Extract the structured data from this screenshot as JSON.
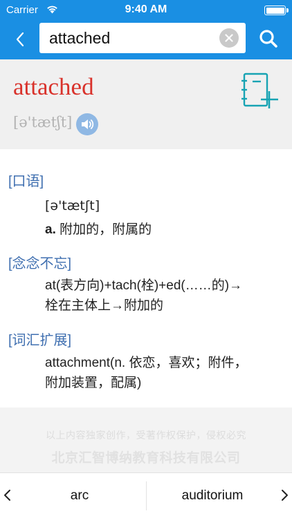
{
  "status_bar": {
    "carrier": "Carrier",
    "time": "9:40 AM"
  },
  "search": {
    "value": "attached"
  },
  "word": {
    "headword": "attached",
    "phonetic": "[ə'tætʃt]"
  },
  "sections": [
    {
      "title": "[口语]",
      "lines": [
        "[ə'tætʃt]"
      ],
      "pos": "a.",
      "definition": " 附加的，附属的"
    },
    {
      "title": "[念念不忘]",
      "lines": [
        "at(表方向)+tach(栓)+ed(……的)→",
        "栓在主体上→附加的"
      ]
    },
    {
      "title": "[词汇扩展]",
      "lines": [
        "attachment(n. 依恋，喜欢；附件，",
        "附加装置，配属)"
      ]
    }
  ],
  "copyright": {
    "line1": "以上内容独家创作，受著作权保护，侵权必究",
    "line2": "北京汇智博纳教育科技有限公司"
  },
  "bottom_nav": {
    "prev_word": "arc",
    "next_word": "auditorium"
  },
  "colors": {
    "header_blue": "#1a8fe3",
    "headword_red": "#d9322b",
    "section_blue": "#3f6fb0",
    "notebook_teal": "#17a3b3"
  },
  "icons": [
    "wifi-icon",
    "battery-icon",
    "chevron-left-icon",
    "clear-icon",
    "search-icon",
    "speaker-icon",
    "notebook-add-icon",
    "chevron-right-icon"
  ]
}
